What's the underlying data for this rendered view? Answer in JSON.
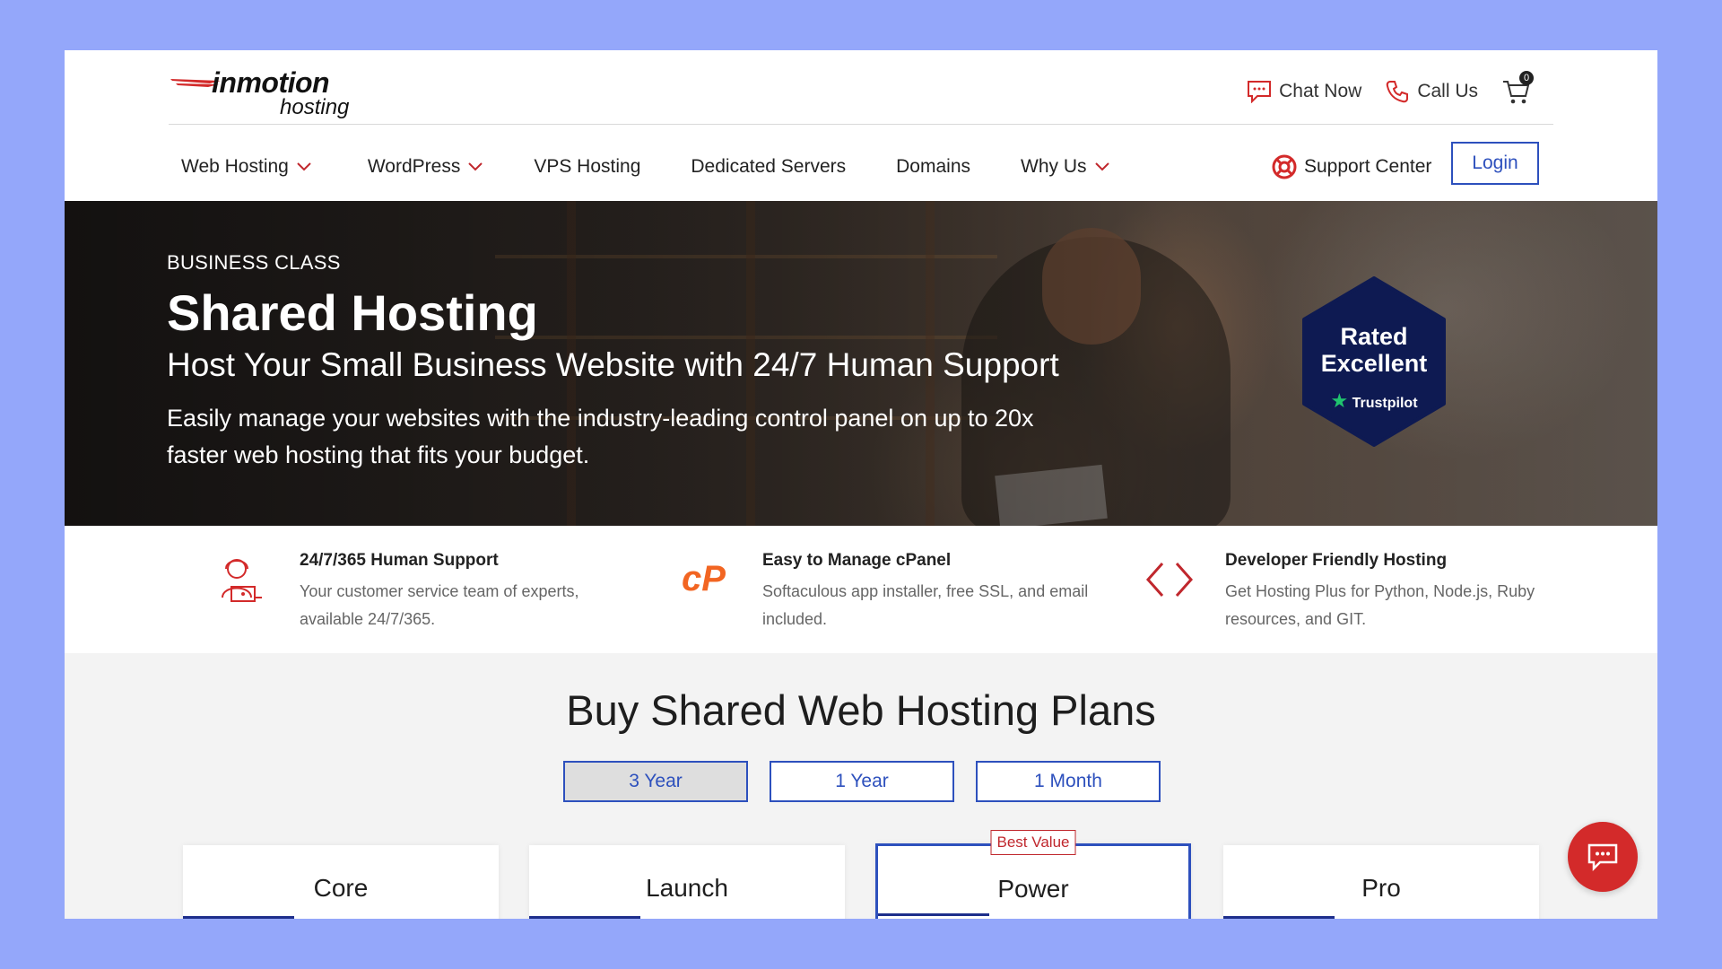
{
  "brand": {
    "name": "inmotion",
    "sub": "hosting",
    "accent": "#d32a2a",
    "link_color": "#2d50bd"
  },
  "top_actions": {
    "chat_label": "Chat Now",
    "call_label": "Call Us",
    "cart_count": "0"
  },
  "nav": {
    "items": [
      {
        "label": "Web Hosting",
        "has_dropdown": true
      },
      {
        "label": "WordPress",
        "has_dropdown": true
      },
      {
        "label": "VPS Hosting",
        "has_dropdown": false
      },
      {
        "label": "Dedicated Servers",
        "has_dropdown": false
      },
      {
        "label": "Domains",
        "has_dropdown": false
      },
      {
        "label": "Why Us",
        "has_dropdown": true
      }
    ],
    "support_label": "Support Center",
    "login_label": "Login"
  },
  "hero": {
    "kicker": "BUSINESS CLASS",
    "title": "Shared Hosting",
    "subtitle": "Host Your Small Business Website with 24/7 Human Support",
    "description": "Easily manage your websites with the industry-leading control panel on up to 20x faster web hosting that fits your budget.",
    "badge": {
      "line1": "Rated",
      "line2": "Excellent",
      "provider": "Trustpilot"
    }
  },
  "features": [
    {
      "icon": "support-agent-icon",
      "title": "24/7/365 Human Support",
      "desc": "Your customer service team of experts, available 24/7/365."
    },
    {
      "icon": "cpanel-icon",
      "title": "Easy to Manage cPanel",
      "desc": "Softaculous app installer, free SSL, and email included."
    },
    {
      "icon": "code-brackets-icon",
      "title": "Developer Friendly Hosting",
      "desc": "Get Hosting Plus for Python, Node.js, Ruby resources, and GIT."
    }
  ],
  "plans": {
    "heading": "Buy Shared Web Hosting Plans",
    "terms": [
      {
        "label": "3 Year",
        "active": true
      },
      {
        "label": "1 Year",
        "active": false
      },
      {
        "label": "1 Month",
        "active": false
      }
    ],
    "cards": [
      {
        "name": "Core",
        "featured": false
      },
      {
        "name": "Launch",
        "featured": false
      },
      {
        "name": "Power",
        "featured": true,
        "ribbon": "Best Value"
      },
      {
        "name": "Pro",
        "featured": false
      }
    ]
  }
}
